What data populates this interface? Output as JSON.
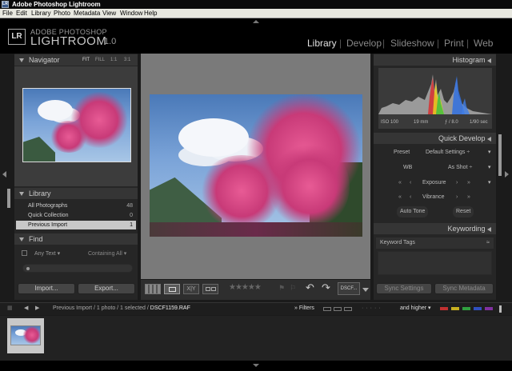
{
  "window": {
    "title": "Adobe Photoshop Lightroom",
    "icon": "LR"
  },
  "menu": [
    "File",
    "Edit",
    "Library",
    "Photo",
    "Metadata",
    "View",
    "Window",
    "Help"
  ],
  "brand": {
    "logo": "LR",
    "line1": "ADOBE PHOTOSHOP",
    "line2": "LIGHTROOM",
    "version": "1.0"
  },
  "modules": [
    "Library",
    "Develop",
    "Slideshow",
    "Print",
    "Web"
  ],
  "active_module": "Library",
  "navigator": {
    "title": "Navigator",
    "zoom_options": [
      "FIT",
      "FILL",
      "1:1",
      "3:1"
    ]
  },
  "library": {
    "title": "Library",
    "rows": [
      {
        "label": "All Photographs",
        "count": "48"
      },
      {
        "label": "Quick Collection",
        "count": "0"
      },
      {
        "label": "Previous Import",
        "count": "1"
      }
    ]
  },
  "find": {
    "title": "Find",
    "text_option": "Any Text",
    "match_option": "Containing All"
  },
  "left_buttons": {
    "import": "Import...",
    "export": "Export..."
  },
  "histogram": {
    "title": "Histogram",
    "iso": "ISO 100",
    "focal": "19 mm",
    "aperture": "ƒ / 8.0",
    "shutter": "1/90 sec"
  },
  "quick_develop": {
    "title": "Quick Develop",
    "preset_label": "Preset",
    "preset_value": "Default Settings",
    "wb_label": "WB",
    "wb_value": "As Shot",
    "exposure": "Exposure",
    "vibrance": "Vibrance",
    "auto_tone": "Auto Tone",
    "reset": "Reset"
  },
  "keywording": {
    "title": "Keywording",
    "tags_label": "Keyword Tags"
  },
  "right_buttons": {
    "sync_settings": "Sync Settings",
    "sync_metadata": "Sync Metadata"
  },
  "toolbar": {
    "sort_label": "DSCF..."
  },
  "filmstrip": {
    "breadcrumb": "Previous Import / 1 photo / 1 selected / ",
    "filename": "DSCF1159.RAF",
    "filters_label": "Filters",
    "rating_filter": "and higher"
  },
  "colors": {
    "accent": "#e0e0e0",
    "panel": "#262626",
    "background": "#1b1b1b"
  }
}
